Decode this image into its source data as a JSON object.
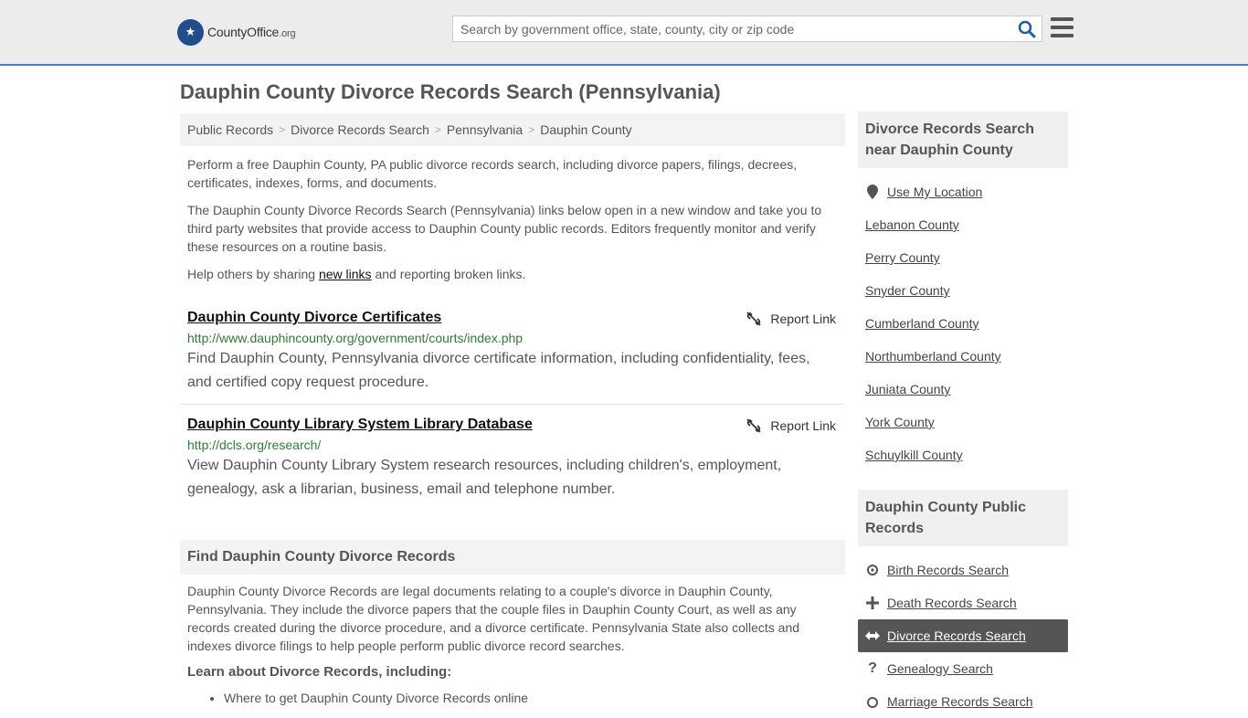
{
  "header": {
    "logo_brand": "CountyOffice",
    "logo_tld": ".org",
    "search_placeholder": "Search by government office, state, county, city or zip code"
  },
  "page_title": "Dauphin County Divorce Records Search (Pennsylvania)",
  "breadcrumb": [
    "Public Records",
    "Divorce Records Search",
    "Pennsylvania",
    "Dauphin County"
  ],
  "intro": {
    "p1": "Perform a free Dauphin County, PA public divorce records search, including divorce papers, filings, decrees, certificates, indexes, forms, and documents.",
    "p2": "The Dauphin County Divorce Records Search (Pennsylvania) links below open in a new window and take you to third party websites that provide access to Dauphin County public records. Editors frequently monitor and verify these resources on a routine basis.",
    "p3_before": "Help others by sharing ",
    "p3_link": "new links",
    "p3_after": " and reporting broken links."
  },
  "results": [
    {
      "title": "Dauphin County Divorce Certificates",
      "url": "http://www.dauphincounty.org/government/courts/index.php",
      "description": "Find Dauphin County, Pennsylvania divorce certificate information, including confidentiality, fees, and certified copy request procedure.",
      "report_label": "Report Link"
    },
    {
      "title": "Dauphin County Library System Library Database",
      "url": "http://dcls.org/research/",
      "description": "View Dauphin County Library System research resources, including children's, employment, genealogy, ask a librarian, business, email and telephone number.",
      "report_label": "Report Link"
    }
  ],
  "find_section": {
    "heading": "Find Dauphin County Divorce Records",
    "body": "Dauphin County Divorce Records are legal documents relating to a couple's divorce in Dauphin County, Pennsylvania. They include the divorce papers that the couple files in Dauphin County Court, as well as any records created during the divorce procedure, and a divorce certificate. Pennsylvania State also collects and indexes divorce filings to help people perform public divorce record searches.",
    "learn_heading": "Learn about Divorce Records, including:",
    "bullets": [
      "Where to get Dauphin County Divorce Records online"
    ]
  },
  "sidebar": {
    "nearby_heading": "Divorce Records Search near Dauphin County",
    "use_location": "Use My Location",
    "nearby": [
      "Lebanon County",
      "Perry County",
      "Snyder County",
      "Cumberland County",
      "Northumberland County",
      "Juniata County",
      "York County",
      "Schuylkill County"
    ],
    "public_heading": "Dauphin County Public Records",
    "public_links": [
      {
        "label": "Birth Records Search",
        "icon": "birth-icon"
      },
      {
        "label": "Death Records Search",
        "icon": "plus-icon"
      },
      {
        "label": "Divorce Records Search",
        "icon": "arrows-icon"
      },
      {
        "label": "Genealogy Search",
        "icon": "question-icon"
      },
      {
        "label": "Marriage Records Search",
        "icon": "ring-icon"
      }
    ]
  }
}
